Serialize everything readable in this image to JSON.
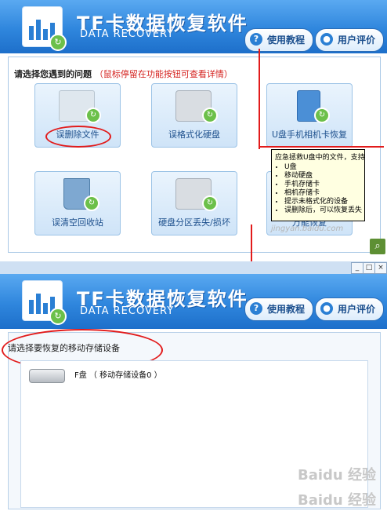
{
  "app": {
    "title": "TF卡数据恢复软件",
    "subtitle": "DATA RECOVERY",
    "tutorial_label": "使用教程",
    "review_label": "用户评价"
  },
  "screen1": {
    "prompt": "请选择您遇到的问题",
    "prompt_hint": "（鼠标停留在功能按钮可查看详情）",
    "tiles": [
      {
        "label": "误删除文件",
        "icon": "folder-icon"
      },
      {
        "label": "误格式化硬盘",
        "icon": "hard-disk-icon"
      },
      {
        "label": "U盘手机相机卡恢复",
        "icon": "usb-drive-icon"
      },
      {
        "label": "误清空回收站",
        "icon": "recycle-bin-icon"
      },
      {
        "label": "硬盘分区丢失/损坏",
        "icon": "partition-disk-icon"
      },
      {
        "label": "万能恢复",
        "icon": "universal-recovery-icon"
      }
    ],
    "tooltip": {
      "heading": "应急拯救U盘中的文件，支持：",
      "items": [
        "U盘",
        "移动硬盘",
        "手机存储卡",
        "相机存储卡",
        "提示未格式化的设备",
        "误删除后，可以恢复丢失"
      ]
    },
    "watermark": "jingyan.baidu.com"
  },
  "screen2": {
    "prompt": "请选择要恢复的移动存储设备",
    "drive_label": "F盘 （ 移动存储设备0 ）",
    "watermark_top": "Baidu 经验",
    "watermark_bottom": "Baidu 经验",
    "window_buttons": [
      "_",
      "□",
      "×"
    ]
  },
  "colors": {
    "header_blue": "#2f86dd",
    "annotation_red": "#e21b1b",
    "tooltip_bg": "#ffffe1",
    "accent_green": "#6cc04a"
  }
}
